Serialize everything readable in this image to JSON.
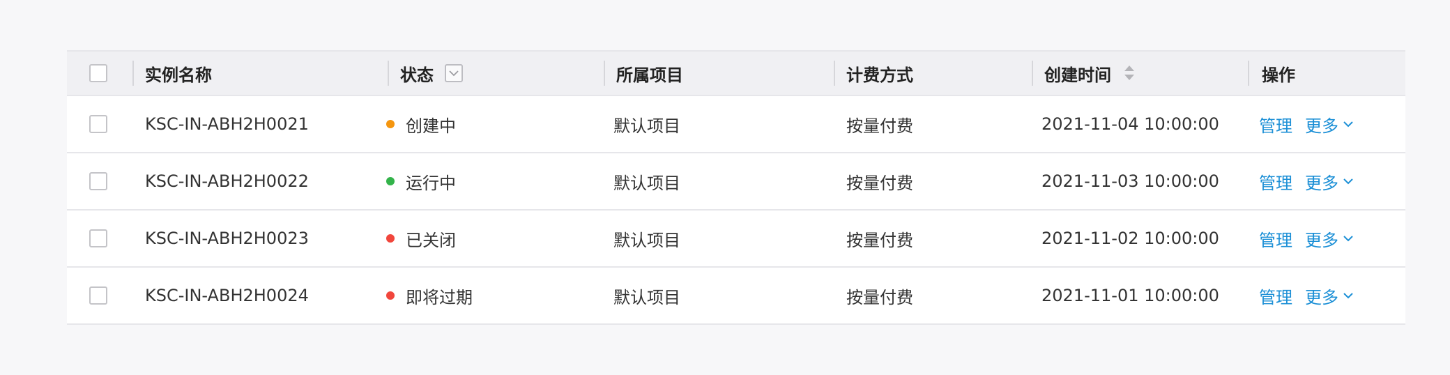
{
  "table": {
    "headers": {
      "name": "实例名称",
      "status": "状态",
      "project": "所属项目",
      "billing": "计费方式",
      "created": "创建时间",
      "actions": "操作"
    },
    "rows": [
      {
        "name": "KSC-IN-ABH2H0021",
        "status": "创建中",
        "status_color": "#f5960f",
        "project": "默认项目",
        "billing": "按量付费",
        "created": "2021-11-04 10:00:00",
        "manage": "管理",
        "more": "更多"
      },
      {
        "name": "KSC-IN-ABH2H0022",
        "status": "运行中",
        "status_color": "#33b34a",
        "project": "默认项目",
        "billing": "按量付费",
        "created": "2021-11-03 10:00:00",
        "manage": "管理",
        "more": "更多"
      },
      {
        "name": "KSC-IN-ABH2H0023",
        "status": "已关闭",
        "status_color": "#f1463c",
        "project": "默认项目",
        "billing": "按量付费",
        "created": "2021-11-02 10:00:00",
        "manage": "管理",
        "more": "更多"
      },
      {
        "name": "KSC-IN-ABH2H0024",
        "status": "即将过期",
        "status_color": "#f1463c",
        "project": "默认项目",
        "billing": "按量付费",
        "created": "2021-11-01 10:00:00",
        "manage": "管理",
        "more": "更多"
      }
    ]
  },
  "colors": {
    "link": "#1b8fd6",
    "header_bg": "#f0f0f3",
    "page_bg": "#f7f7f9"
  },
  "icons": {
    "filter": "filter-dropdown-icon",
    "sort": "sort-icon",
    "more_chevron": "chevron-down-icon"
  }
}
